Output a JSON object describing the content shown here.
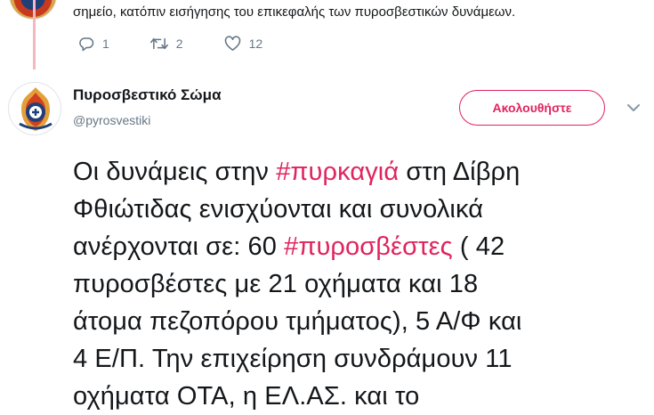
{
  "previous_tweet": {
    "text": "σημείο, κατόπιν εισήγησης του επικεφαλής των πυροσβεστικών δυνάμεων.",
    "actions": {
      "replies": "1",
      "retweets": "2",
      "likes": "12"
    }
  },
  "tweet": {
    "author_name": "Πυροσβεστικό Σώμα",
    "author_handle": "@pyrosvestiki",
    "follow_label": "Ακολουθήστε",
    "lines": [
      [
        {
          "t": "Οι δυνάμεις στην "
        },
        {
          "t": "#πυρκαγιά",
          "hashtag": true
        },
        {
          "t": " στη  Δίβρη"
        }
      ],
      [
        {
          "t": "Φθιώτιδας ενισχύονται και συνολικά"
        }
      ],
      [
        {
          "t": "ανέρχονται σε:  60 "
        },
        {
          "t": "#πυροσβέστες",
          "hashtag": true
        },
        {
          "t": " ( 42"
        }
      ],
      [
        {
          "t": "πυροσβέστες με 21 οχήματα και 18"
        }
      ],
      [
        {
          "t": "άτομα πεζοπόρου τμήματος), 5 Α/Φ και"
        }
      ],
      [
        {
          "t": "4 Ε/Π. Την επιχείρηση συνδράμουν 11"
        }
      ],
      [
        {
          "t": "οχήματα ΟΤΑ, η ΕΛ.ΑΣ. και το"
        }
      ]
    ]
  },
  "colors": {
    "accent": "#e0245e",
    "text": "#14171a",
    "muted": "#657786",
    "thread_line": "#f4b8c2"
  },
  "icons": {
    "reply": "reply-icon",
    "retweet": "retweet-icon",
    "like": "heart-icon",
    "caret": "chevron-down-icon",
    "avatar": "fire-service-emblem"
  }
}
